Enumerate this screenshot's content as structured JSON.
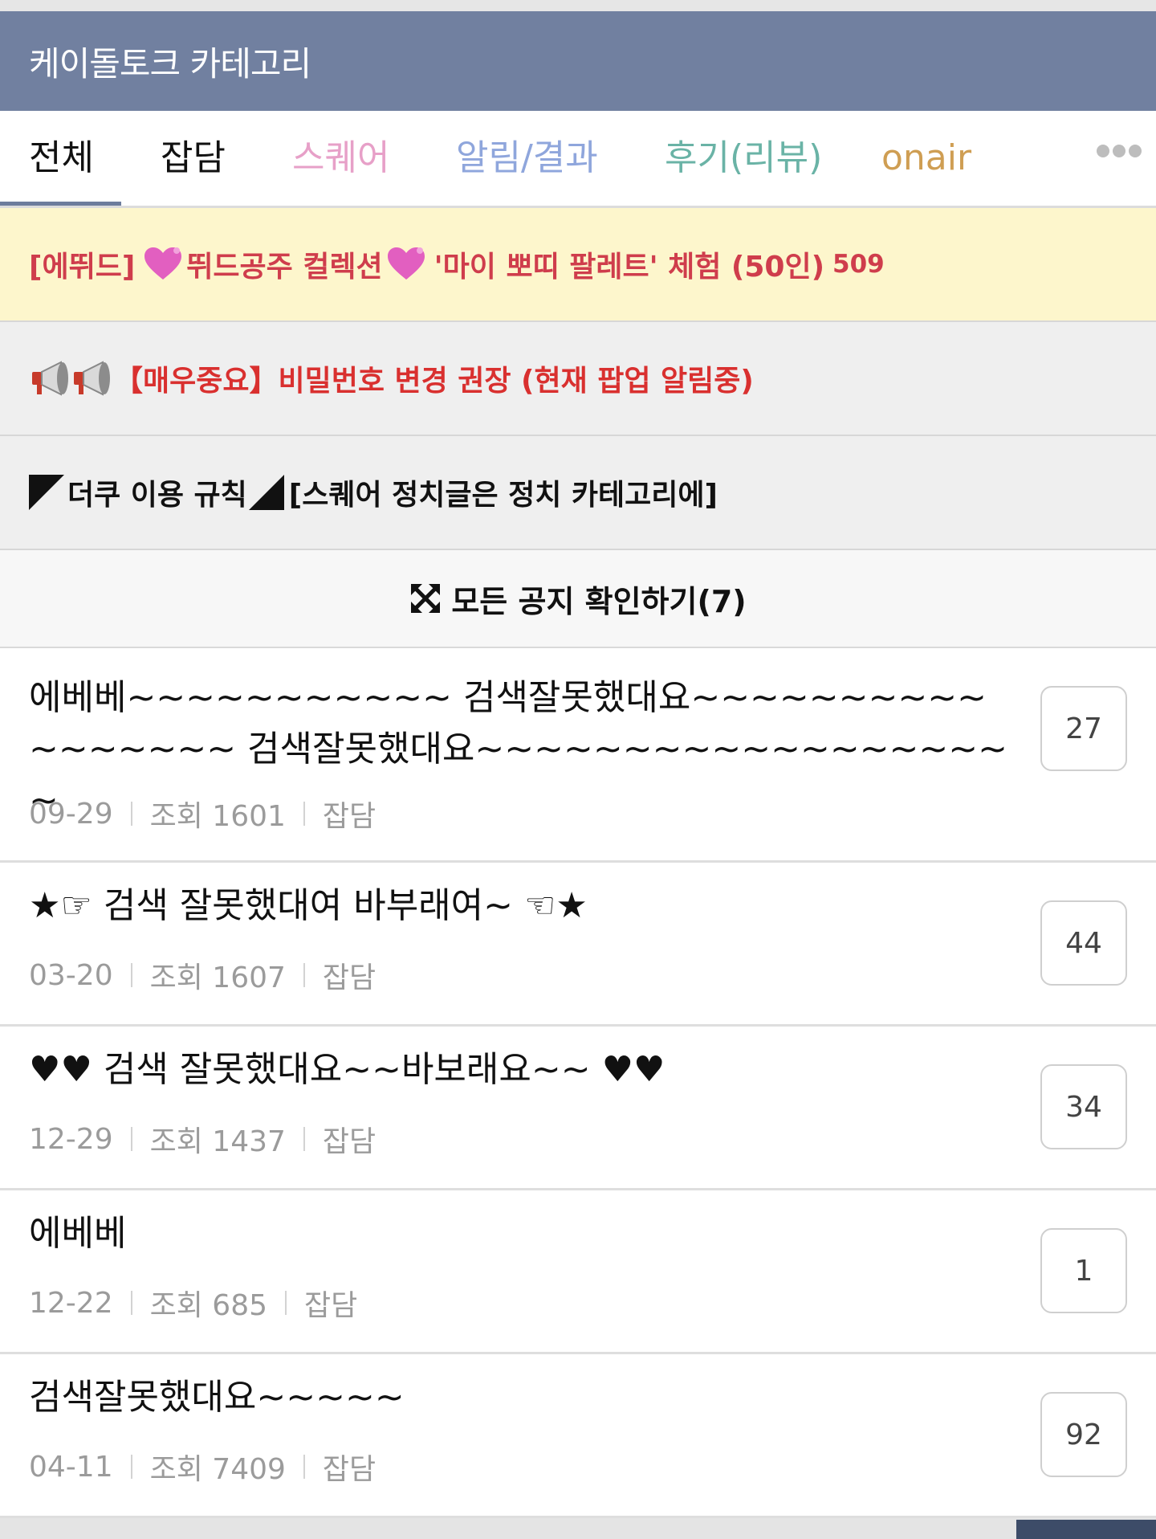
{
  "header": {
    "title": "케이돌토크 카테고리"
  },
  "tabs": [
    {
      "label": "전체",
      "color": "#111111",
      "active": true
    },
    {
      "label": "잡담",
      "color": "#111111"
    },
    {
      "label": "스퀘어",
      "color": "#e7a0c8"
    },
    {
      "label": "알림/결과",
      "color": "#8fa6dc"
    },
    {
      "label": "후기(리뷰)",
      "color": "#6ab3a6"
    },
    {
      "label": "onair",
      "color": "#cf9e53"
    }
  ],
  "notices": [
    {
      "prefix": "[에뛰드]",
      "middle": "뛰드공주 컬렉션",
      "suffix": "'마이 뽀띠 팔레트' 체험 (50인)",
      "count": "509",
      "icon": "heart-icon"
    },
    {
      "text": "【매우중요】비밀번호 변경 권장 (현재 팝업 알림중)",
      "icon": "megaphone-icon"
    },
    {
      "left": "더쿠 이용 규칙",
      "right": "[스퀘어 정치글은 정치 카테고리에]"
    }
  ],
  "all_notices_label": "모든 공지 확인하기(7)",
  "posts": [
    {
      "title": "에베베~~~~~~~~~~~ 검색잘못했대요~~~~~~~~~~~~~~~~~ 검색잘못했대요~~~~~~~~~~~~~~~~~~~",
      "date": "09-29",
      "views": "조회 1601",
      "category": "잡담",
      "comments": "27"
    },
    {
      "title": "★☞ 검색 잘못했대여 바부래여~ ☜★",
      "date": "03-20",
      "views": "조회 1607",
      "category": "잡담",
      "comments": "44"
    },
    {
      "title": "♥♥ 검색 잘못했대요~~바보래요~~ ♥♥",
      "date": "12-29",
      "views": "조회 1437",
      "category": "잡담",
      "comments": "34"
    },
    {
      "title": "에베베",
      "date": "12-22",
      "views": "조회 685",
      "category": "잡담",
      "comments": "1"
    },
    {
      "title": "검색잘못했대요~~~~~",
      "date": "04-11",
      "views": "조회 7409",
      "category": "잡담",
      "comments": "92"
    }
  ]
}
